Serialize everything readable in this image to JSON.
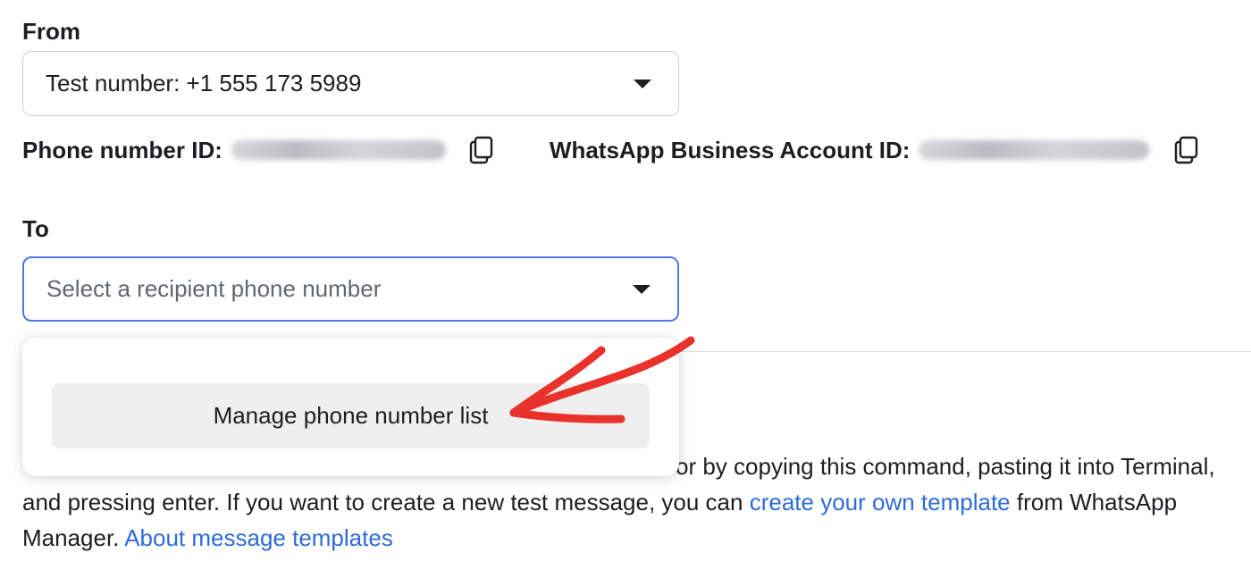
{
  "from": {
    "label": "From",
    "selected_value": "Test number: +1 555 173 5989"
  },
  "ids": {
    "phone_number_id_label": "Phone number ID:",
    "waba_id_label": "WhatsApp Business Account ID:"
  },
  "to": {
    "label": "To",
    "placeholder": "Select a recipient phone number"
  },
  "dropdown": {
    "manage_label": "Manage phone number list"
  },
  "description": {
    "text_1": "or by copying this command, pasting it into Terminal, and pressing enter. If you want to create a new test message, you can ",
    "link_1": "create your own template",
    "text_2": " from WhatsApp Manager. ",
    "link_2": "About message templates"
  },
  "colors": {
    "link": "#2e6bd9",
    "focus_border": "#4c7be0",
    "annotation_arrow": "#e8322b"
  },
  "icons": [
    "copy-icon",
    "caret-down-icon",
    "annotation-arrow"
  ]
}
